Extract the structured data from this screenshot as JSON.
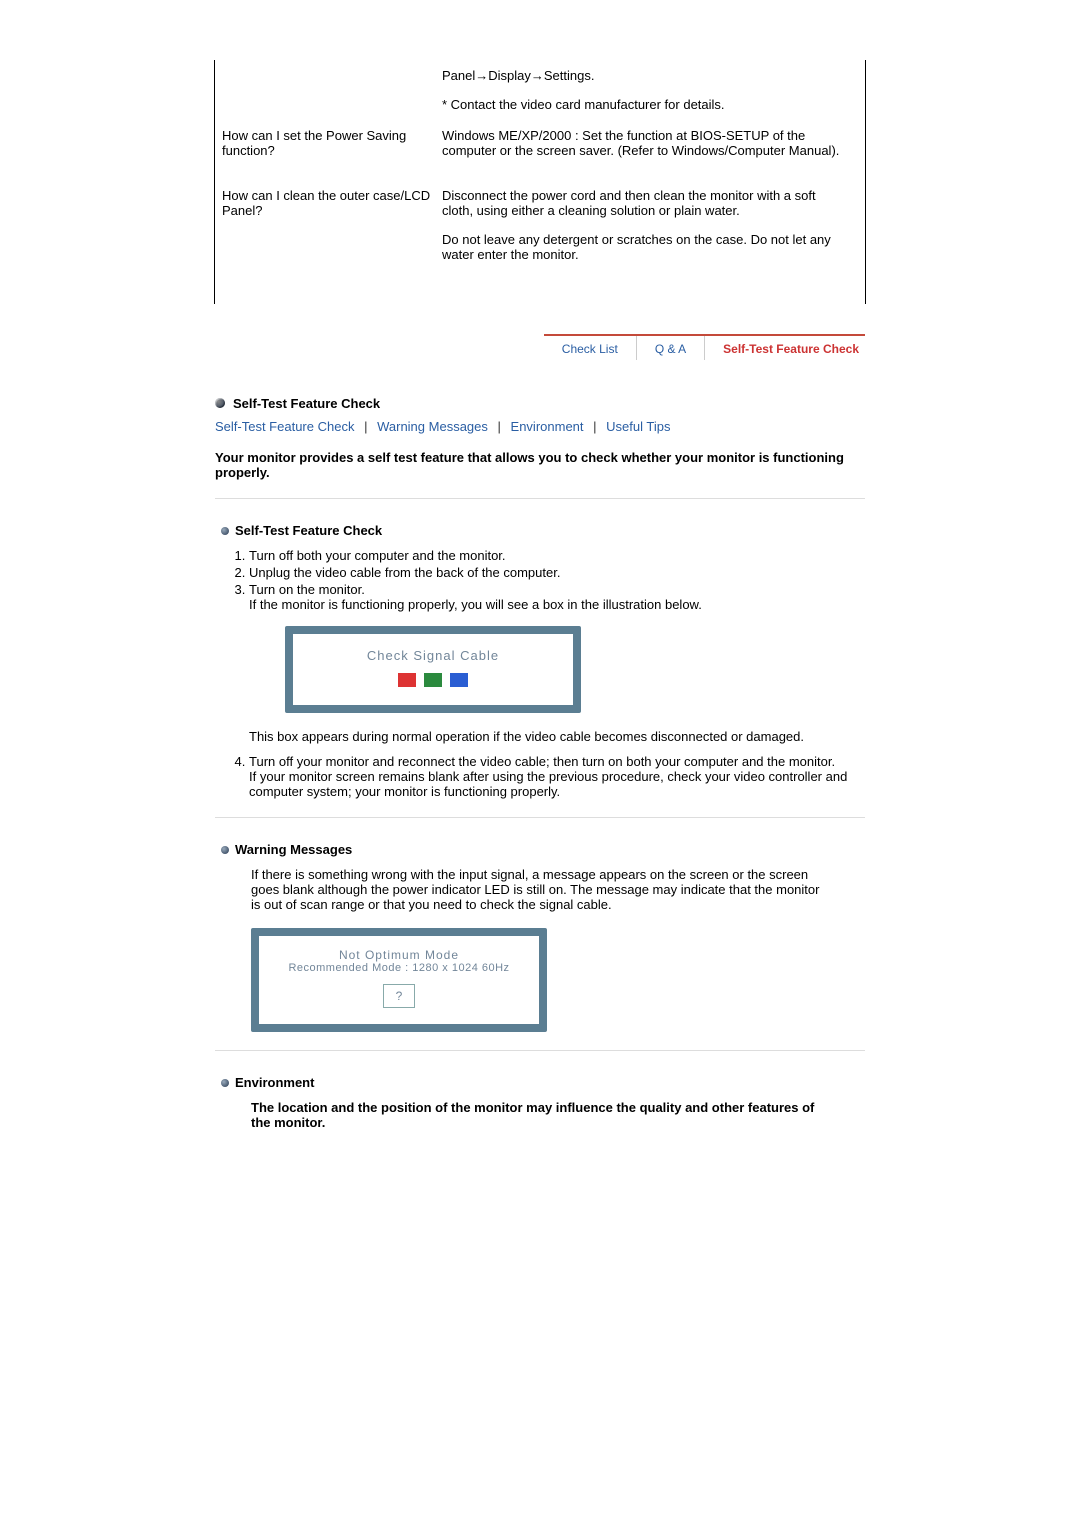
{
  "qa": [
    {
      "q": "",
      "a": [
        "Panel→Display→Settings.",
        "* Contact the video card manufacturer for details."
      ]
    },
    {
      "q": "How can I set the Power Saving function?",
      "a": [
        "Windows ME/XP/2000 : Set the function at BIOS-SETUP of the computer or the screen saver. (Refer to Windows/Computer Manual)."
      ]
    },
    {
      "q": "How can I clean the outer case/LCD Panel?",
      "a": [
        "Disconnect the power cord and then clean the monitor with a soft cloth, using either a cleaning solution or plain water.",
        "Do not leave any detergent or scratches on the case. Do not let any water enter the monitor."
      ]
    }
  ],
  "tabs": {
    "items": [
      "Check List",
      "Q & A",
      "Self-Test Feature Check"
    ],
    "active": 2
  },
  "section": {
    "title": "Self-Test Feature Check",
    "links": [
      "Self-Test Feature Check",
      "Warning Messages",
      "Environment",
      "Useful Tips"
    ],
    "lead": "Your monitor provides a self test feature that allows you to check whether your monitor is functioning properly."
  },
  "selftest": {
    "title": "Self-Test Feature Check",
    "steps": [
      "Turn off both your computer and the monitor.",
      "Unplug the video cable from the back of the computer.",
      "Turn on the monitor."
    ],
    "step3_note": "If the monitor is functioning properly, you will see a box in the illustration below.",
    "signal_text": "Check Signal Cable",
    "after_box": "This box appears during normal operation if the video cable becomes disconnected or damaged.",
    "step4": "Turn off your monitor and reconnect the video cable; then turn on both your computer and the monitor.",
    "step4_note": "If your monitor screen remains blank after using the previous procedure, check your video controller and computer system; your monitor is functioning properly."
  },
  "warning": {
    "title": "Warning Messages",
    "text": "If there is something wrong with the input signal, a message appears on the screen or the screen goes blank although the power indicator LED is still on. The message may indicate that the monitor is out of scan range or that you need to check the signal cable.",
    "mode_line1": "Not Optimum Mode",
    "mode_line2": "Recommended Mode : 1280 x 1024  60Hz",
    "mode_btn": "?"
  },
  "environment": {
    "title": "Environment",
    "text": "The location and the position of the monitor may influence the quality and other features of the monitor."
  }
}
